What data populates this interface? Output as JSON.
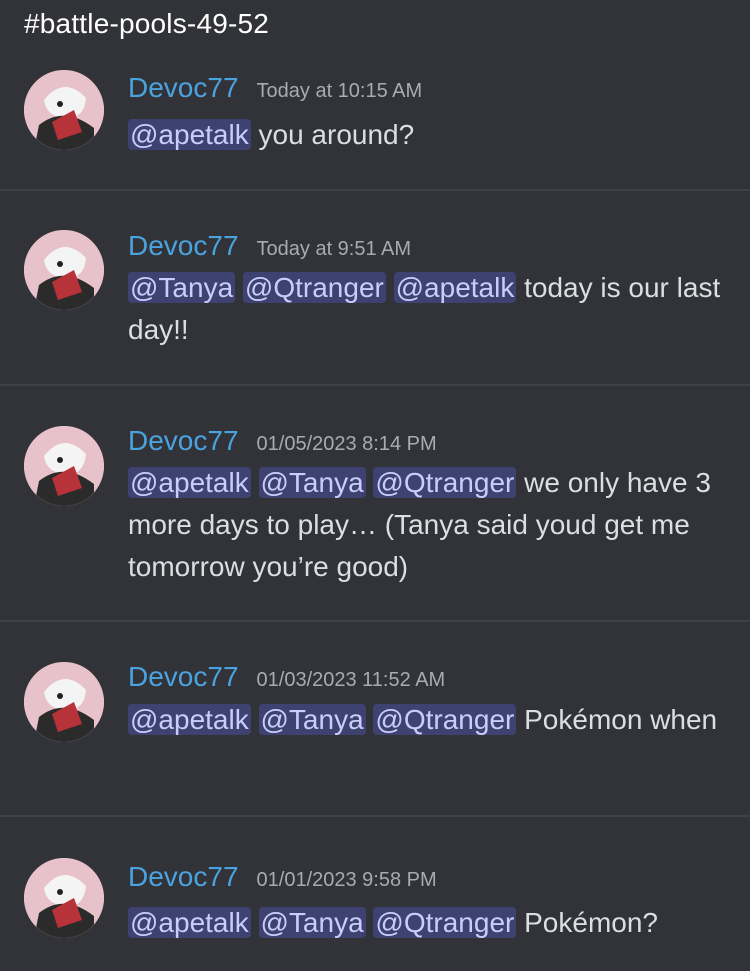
{
  "channel": {
    "title": "#battle-pools-49-52"
  },
  "messages": [
    {
      "username": "Devoc77",
      "timestamp": "Today at 10:15 AM",
      "mentions": [
        "@apetalk"
      ],
      "text": "you around?"
    },
    {
      "username": "Devoc77",
      "timestamp": "Today at 9:51 AM",
      "mentions": [
        "@Tanya",
        "@Qtranger",
        "@apetalk"
      ],
      "text": "today is our last day!!"
    },
    {
      "username": "Devoc77",
      "timestamp": "01/05/2023 8:14 PM",
      "mentions": [
        "@apetalk",
        "@Tanya",
        "@Qtranger"
      ],
      "text": "we only have 3 more days to play… (Tanya said youd get me tomorrow you’re good)"
    },
    {
      "username": "Devoc77",
      "timestamp": "01/03/2023 11:52 AM",
      "mentions": [
        "@apetalk",
        "@Tanya",
        "@Qtranger"
      ],
      "text": "Pokémon when"
    },
    {
      "username": "Devoc77",
      "timestamp": "01/01/2023 9:58 PM",
      "mentions": [
        "@apetalk",
        "@Tanya",
        "@Qtranger"
      ],
      "text": "Pokémon?"
    }
  ],
  "colors": {
    "background": "#313338",
    "username": "#4aa3df",
    "mention_bg": "#3e4270",
    "mention_text": "#c9cdfb"
  }
}
